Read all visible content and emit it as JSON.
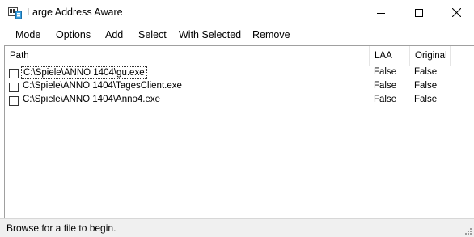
{
  "window": {
    "title": "Large Address Aware"
  },
  "menu": {
    "items": [
      "Mode",
      "Options",
      "Add",
      "Select",
      "With Selected",
      "Remove"
    ]
  },
  "list": {
    "columns": [
      "Path",
      "LAA",
      "Original"
    ],
    "rows": [
      {
        "checked": false,
        "path": "C:\\Spiele\\ANNO 1404\\gu.exe",
        "laa": "False",
        "original": "False"
      },
      {
        "checked": false,
        "path": "C:\\Spiele\\ANNO 1404\\TagesClient.exe",
        "laa": "False",
        "original": "False"
      },
      {
        "checked": false,
        "path": "C:\\Spiele\\ANNO 1404\\Anno4.exe",
        "laa": "False",
        "original": "False"
      }
    ]
  },
  "status": {
    "text": "Browse for a file to begin."
  },
  "colors": {
    "border": "#a0a0a0",
    "statusbar": "#f0f0f0"
  }
}
